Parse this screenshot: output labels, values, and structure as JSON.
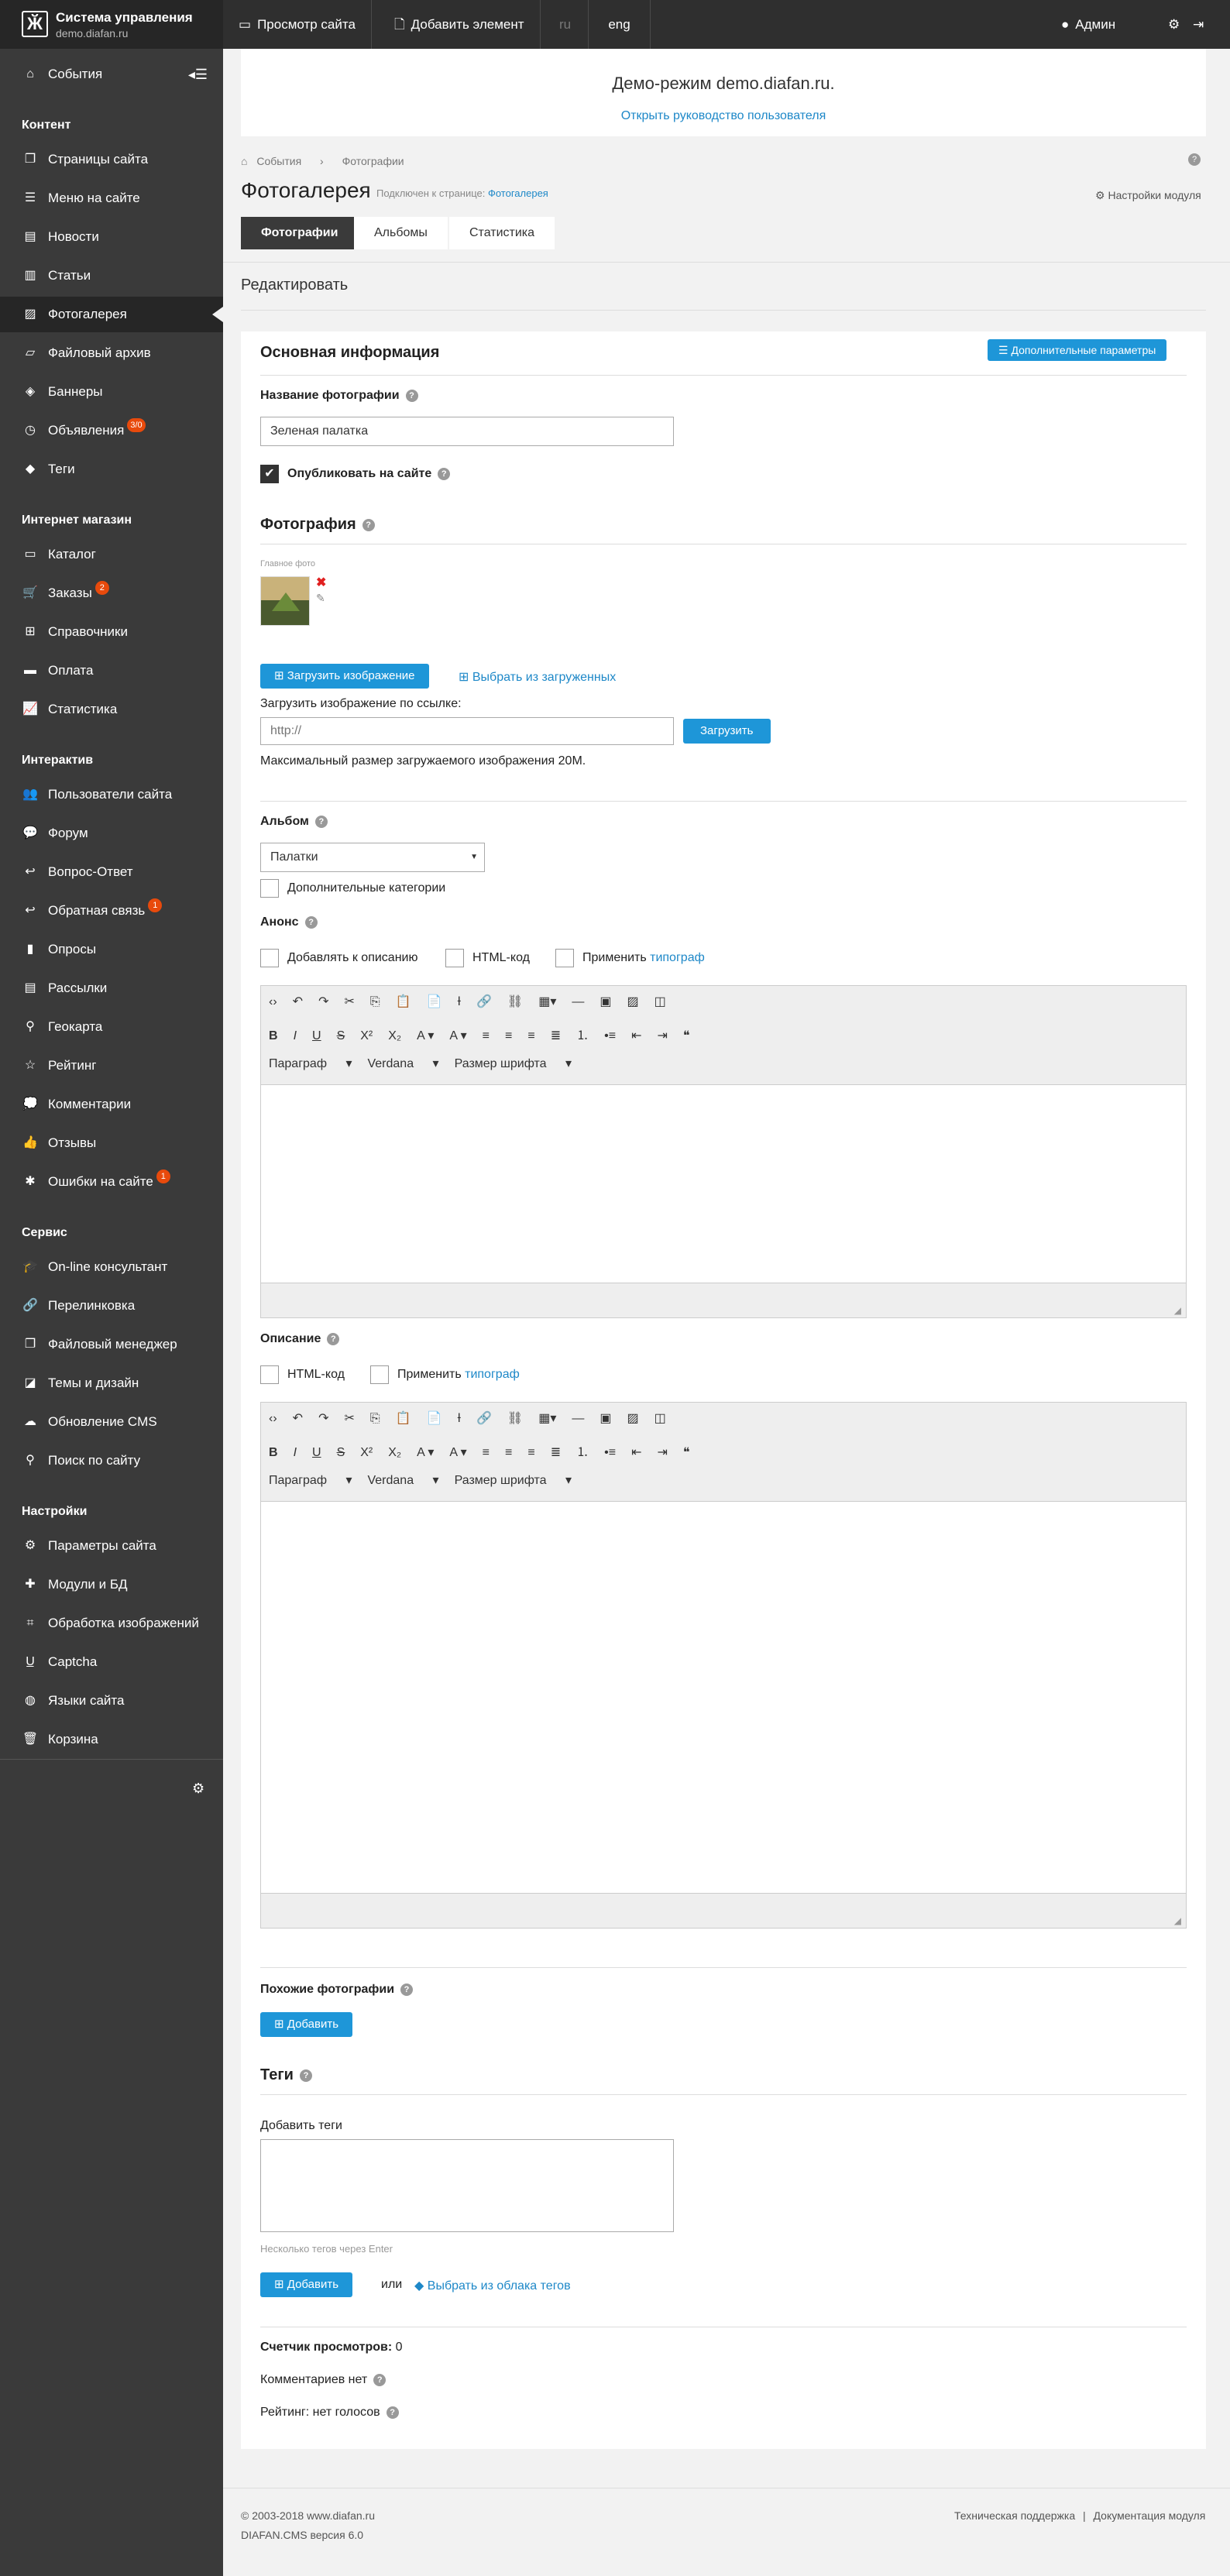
{
  "app": {
    "title": "Система управления",
    "domain": "demo.diafan.ru"
  },
  "topbar": {
    "view_site": "Просмотр сайта",
    "add_element": "Добавить элемент",
    "lang_ru": "ru",
    "lang_eng": "eng",
    "user": "Админ"
  },
  "sidebar": {
    "events": "События",
    "sections": [
      {
        "title": "Контент",
        "items": [
          "Страницы сайта",
          "Меню на сайте",
          "Новости",
          "Статьи",
          "Фотогалерея",
          "Файловый архив",
          "Баннеры",
          "Объявления",
          "Теги"
        ]
      },
      {
        "title": "Интернет магазин",
        "items": [
          "Каталог",
          "Заказы",
          "Справочники",
          "Оплата",
          "Статистика"
        ]
      },
      {
        "title": "Интерактив",
        "items": [
          "Пользователи сайта",
          "Форум",
          "Вопрос-Ответ",
          "Обратная связь",
          "Опросы",
          "Рассылки",
          "Геокарта",
          "Рейтинг",
          "Комментарии",
          "Отзывы",
          "Ошибки на сайте"
        ]
      },
      {
        "title": "Сервис",
        "items": [
          "On-line консультант",
          "Перелинковка",
          "Файловый менеджер",
          "Темы и дизайн",
          "Обновление CMS",
          "Поиск по сайту"
        ]
      },
      {
        "title": "Настройки",
        "items": [
          "Параметры сайта",
          "Модули и БД",
          "Обработка изображений",
          "Captcha",
          "Языки сайта",
          "Корзина"
        ]
      }
    ],
    "badges": {
      "ads": "3/0",
      "orders": "2",
      "feedback": "1",
      "errors": "1"
    }
  },
  "demo": {
    "text": "Демо-режим demo.diafan.ru.",
    "link": "Открыть руководство пользователя"
  },
  "header": {
    "breadcrumb": [
      "События",
      "Фотографии"
    ],
    "title": "Фотогалерея",
    "connected_prefix": "Подключен к странице:",
    "connected_page": "Фотогалерея",
    "module_settings": "Настройки модуля",
    "tabs": [
      "Фотографии",
      "Альбомы",
      "Статистика"
    ]
  },
  "edit": {
    "heading": "Редактировать",
    "main_info": "Основная информация",
    "extra_params": "Дополнительные параметры",
    "name_label": "Название фотографии",
    "name_value": "Зеленая палатка",
    "publish_label": "Опубликовать на сайте",
    "photo_heading": "Фотография",
    "main_photo": "Главное фото",
    "upload_btn": "Загрузить изображение",
    "choose_uploaded": "Выбрать из загруженных",
    "upload_by_url": "Загрузить изображение по ссылке:",
    "url_placeholder": "http://",
    "upload_url_btn": "Загрузить",
    "max_size": "Максимальный размер загружаемого изображения 20M.",
    "album_label": "Альбом",
    "album_value": "Палатки",
    "extra_cats": "Дополнительные категории",
    "anons_label": "Анонс",
    "add_to_desc": "Добавлять к описанию",
    "html_code": "HTML-код",
    "apply": "Применить",
    "typograph": "типограф",
    "desc_label": "Описание",
    "editor": {
      "paragraph": "Параграф",
      "font": "Verdana",
      "size": "Размер шрифта"
    },
    "similar_label": "Похожие фотографии",
    "add_btn": "Добавить",
    "tags_heading": "Теги",
    "add_tags": "Добавить теги",
    "tags_hint": "Несколько тегов через Enter",
    "or": "или",
    "tag_cloud": "Выбрать из облака тегов",
    "views_label": "Счетчик просмотров:",
    "views_value": "0",
    "comments": "Комментариев нет",
    "rating": "Рейтинг: нет голосов"
  },
  "footer": {
    "copyright": "© 2003-2018 www.diafan.ru",
    "version": "DIAFAN.CMS версия 6.0",
    "support": "Техническая поддержка",
    "sep": "|",
    "docs": "Документация модуля"
  }
}
